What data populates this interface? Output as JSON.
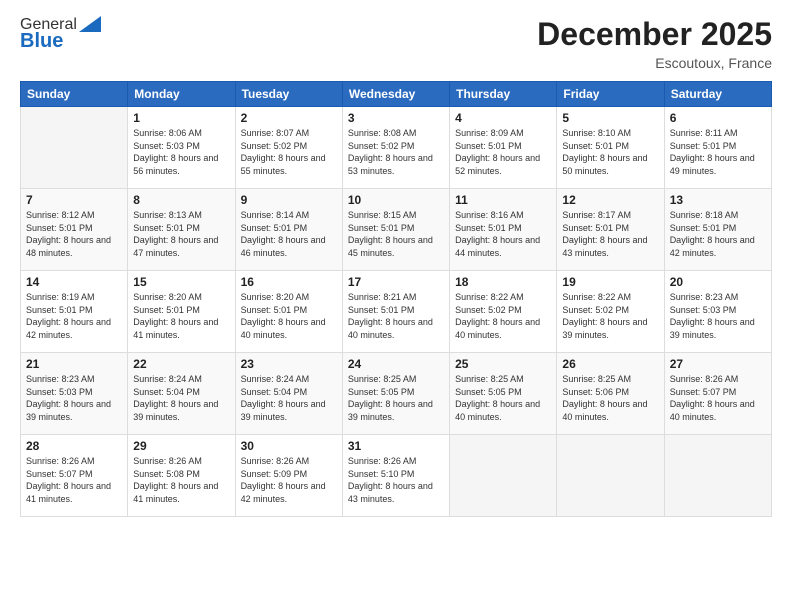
{
  "logo": {
    "general": "General",
    "blue": "Blue"
  },
  "header": {
    "month": "December 2025",
    "location": "Escoutoux, France"
  },
  "weekdays": [
    "Sunday",
    "Monday",
    "Tuesday",
    "Wednesday",
    "Thursday",
    "Friday",
    "Saturday"
  ],
  "weeks": [
    [
      {
        "day": "",
        "sunrise": "",
        "sunset": "",
        "daylight": ""
      },
      {
        "day": "1",
        "sunrise": "Sunrise: 8:06 AM",
        "sunset": "Sunset: 5:03 PM",
        "daylight": "Daylight: 8 hours and 56 minutes."
      },
      {
        "day": "2",
        "sunrise": "Sunrise: 8:07 AM",
        "sunset": "Sunset: 5:02 PM",
        "daylight": "Daylight: 8 hours and 55 minutes."
      },
      {
        "day": "3",
        "sunrise": "Sunrise: 8:08 AM",
        "sunset": "Sunset: 5:02 PM",
        "daylight": "Daylight: 8 hours and 53 minutes."
      },
      {
        "day": "4",
        "sunrise": "Sunrise: 8:09 AM",
        "sunset": "Sunset: 5:01 PM",
        "daylight": "Daylight: 8 hours and 52 minutes."
      },
      {
        "day": "5",
        "sunrise": "Sunrise: 8:10 AM",
        "sunset": "Sunset: 5:01 PM",
        "daylight": "Daylight: 8 hours and 50 minutes."
      },
      {
        "day": "6",
        "sunrise": "Sunrise: 8:11 AM",
        "sunset": "Sunset: 5:01 PM",
        "daylight": "Daylight: 8 hours and 49 minutes."
      }
    ],
    [
      {
        "day": "7",
        "sunrise": "Sunrise: 8:12 AM",
        "sunset": "Sunset: 5:01 PM",
        "daylight": "Daylight: 8 hours and 48 minutes."
      },
      {
        "day": "8",
        "sunrise": "Sunrise: 8:13 AM",
        "sunset": "Sunset: 5:01 PM",
        "daylight": "Daylight: 8 hours and 47 minutes."
      },
      {
        "day": "9",
        "sunrise": "Sunrise: 8:14 AM",
        "sunset": "Sunset: 5:01 PM",
        "daylight": "Daylight: 8 hours and 46 minutes."
      },
      {
        "day": "10",
        "sunrise": "Sunrise: 8:15 AM",
        "sunset": "Sunset: 5:01 PM",
        "daylight": "Daylight: 8 hours and 45 minutes."
      },
      {
        "day": "11",
        "sunrise": "Sunrise: 8:16 AM",
        "sunset": "Sunset: 5:01 PM",
        "daylight": "Daylight: 8 hours and 44 minutes."
      },
      {
        "day": "12",
        "sunrise": "Sunrise: 8:17 AM",
        "sunset": "Sunset: 5:01 PM",
        "daylight": "Daylight: 8 hours and 43 minutes."
      },
      {
        "day": "13",
        "sunrise": "Sunrise: 8:18 AM",
        "sunset": "Sunset: 5:01 PM",
        "daylight": "Daylight: 8 hours and 42 minutes."
      }
    ],
    [
      {
        "day": "14",
        "sunrise": "Sunrise: 8:19 AM",
        "sunset": "Sunset: 5:01 PM",
        "daylight": "Daylight: 8 hours and 42 minutes."
      },
      {
        "day": "15",
        "sunrise": "Sunrise: 8:20 AM",
        "sunset": "Sunset: 5:01 PM",
        "daylight": "Daylight: 8 hours and 41 minutes."
      },
      {
        "day": "16",
        "sunrise": "Sunrise: 8:20 AM",
        "sunset": "Sunset: 5:01 PM",
        "daylight": "Daylight: 8 hours and 40 minutes."
      },
      {
        "day": "17",
        "sunrise": "Sunrise: 8:21 AM",
        "sunset": "Sunset: 5:01 PM",
        "daylight": "Daylight: 8 hours and 40 minutes."
      },
      {
        "day": "18",
        "sunrise": "Sunrise: 8:22 AM",
        "sunset": "Sunset: 5:02 PM",
        "daylight": "Daylight: 8 hours and 40 minutes."
      },
      {
        "day": "19",
        "sunrise": "Sunrise: 8:22 AM",
        "sunset": "Sunset: 5:02 PM",
        "daylight": "Daylight: 8 hours and 39 minutes."
      },
      {
        "day": "20",
        "sunrise": "Sunrise: 8:23 AM",
        "sunset": "Sunset: 5:03 PM",
        "daylight": "Daylight: 8 hours and 39 minutes."
      }
    ],
    [
      {
        "day": "21",
        "sunrise": "Sunrise: 8:23 AM",
        "sunset": "Sunset: 5:03 PM",
        "daylight": "Daylight: 8 hours and 39 minutes."
      },
      {
        "day": "22",
        "sunrise": "Sunrise: 8:24 AM",
        "sunset": "Sunset: 5:04 PM",
        "daylight": "Daylight: 8 hours and 39 minutes."
      },
      {
        "day": "23",
        "sunrise": "Sunrise: 8:24 AM",
        "sunset": "Sunset: 5:04 PM",
        "daylight": "Daylight: 8 hours and 39 minutes."
      },
      {
        "day": "24",
        "sunrise": "Sunrise: 8:25 AM",
        "sunset": "Sunset: 5:05 PM",
        "daylight": "Daylight: 8 hours and 39 minutes."
      },
      {
        "day": "25",
        "sunrise": "Sunrise: 8:25 AM",
        "sunset": "Sunset: 5:05 PM",
        "daylight": "Daylight: 8 hours and 40 minutes."
      },
      {
        "day": "26",
        "sunrise": "Sunrise: 8:25 AM",
        "sunset": "Sunset: 5:06 PM",
        "daylight": "Daylight: 8 hours and 40 minutes."
      },
      {
        "day": "27",
        "sunrise": "Sunrise: 8:26 AM",
        "sunset": "Sunset: 5:07 PM",
        "daylight": "Daylight: 8 hours and 40 minutes."
      }
    ],
    [
      {
        "day": "28",
        "sunrise": "Sunrise: 8:26 AM",
        "sunset": "Sunset: 5:07 PM",
        "daylight": "Daylight: 8 hours and 41 minutes."
      },
      {
        "day": "29",
        "sunrise": "Sunrise: 8:26 AM",
        "sunset": "Sunset: 5:08 PM",
        "daylight": "Daylight: 8 hours and 41 minutes."
      },
      {
        "day": "30",
        "sunrise": "Sunrise: 8:26 AM",
        "sunset": "Sunset: 5:09 PM",
        "daylight": "Daylight: 8 hours and 42 minutes."
      },
      {
        "day": "31",
        "sunrise": "Sunrise: 8:26 AM",
        "sunset": "Sunset: 5:10 PM",
        "daylight": "Daylight: 8 hours and 43 minutes."
      },
      {
        "day": "",
        "sunrise": "",
        "sunset": "",
        "daylight": ""
      },
      {
        "day": "",
        "sunrise": "",
        "sunset": "",
        "daylight": ""
      },
      {
        "day": "",
        "sunrise": "",
        "sunset": "",
        "daylight": ""
      }
    ]
  ]
}
